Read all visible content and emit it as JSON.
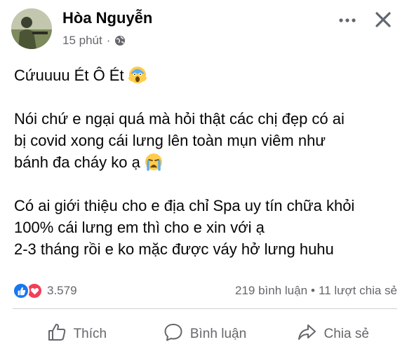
{
  "post": {
    "author": "Hòa Nguyễn",
    "time": "15 phút",
    "dot": "·",
    "privacy_icon": "globe-icon",
    "content": [
      "Cứuuuu Ét Ô Ét",
      "",
      "Nói chứ e ngại quá mà hỏi thật các chị đẹp có ai",
      "bị covid xong cái lưng lên toàn mụn viêm như",
      "bánh đa cháy ko ạ",
      "",
      "Có ai giới thiệu cho e địa chỉ Spa uy tín chữa khỏi",
      "100% cái lưng em thì cho e xin với ạ",
      "2-3 tháng rồi e ko mặc được váy hở lưng huhu"
    ],
    "emojis": [
      "screaming-face-icon",
      "crying-face-icon"
    ]
  },
  "stats": {
    "reactions": "3.579",
    "comments": "219 bình luận",
    "separator": "•",
    "shares": "11 lượt chia sẻ"
  },
  "actions": {
    "like": "Thích",
    "comment": "Bình luận",
    "share": "Chia sẻ"
  },
  "colors": {
    "like_blue": "#1877f2",
    "love_red": "#f33e58",
    "secondary_text": "#65676b"
  }
}
